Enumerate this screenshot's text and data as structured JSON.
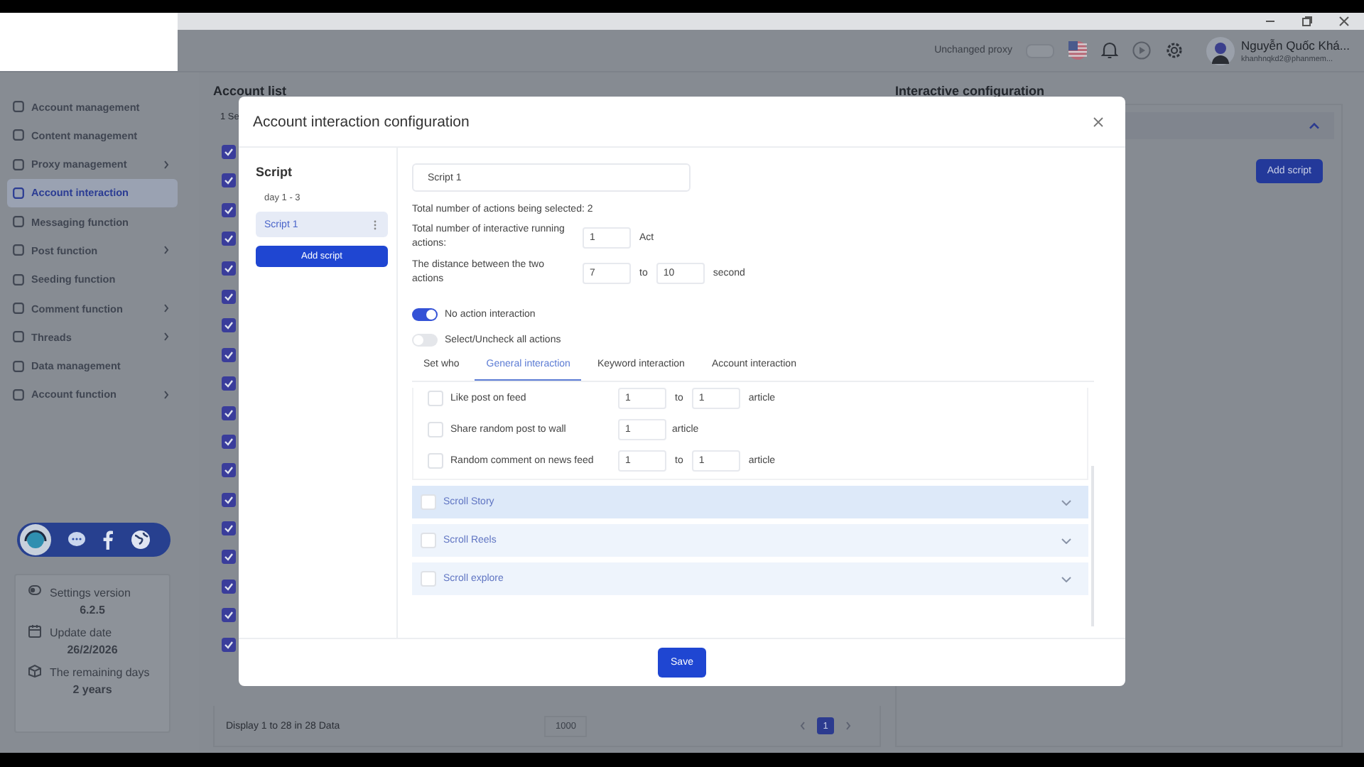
{
  "header": {
    "proxy_label": "Unchanged proxy",
    "proxy_on": false,
    "user_name": "Nguyễn Quốc Khá...",
    "user_email": "khanhnqkd2@phanmem..."
  },
  "sidebar": {
    "items": [
      {
        "label": "Account management",
        "selected": false,
        "has_submenu": false
      },
      {
        "label": "Content management",
        "selected": false,
        "has_submenu": false
      },
      {
        "label": "Proxy management",
        "selected": false,
        "has_submenu": true
      },
      {
        "label": "Account interaction",
        "selected": true,
        "has_submenu": false
      },
      {
        "label": "Messaging function",
        "selected": false,
        "has_submenu": false
      },
      {
        "label": "Post function",
        "selected": false,
        "has_submenu": true
      },
      {
        "label": "Seeding function",
        "selected": false,
        "has_submenu": false
      },
      {
        "label": "Comment function",
        "selected": false,
        "has_submenu": true
      },
      {
        "label": "Threads",
        "selected": false,
        "has_submenu": true
      },
      {
        "label": "Data management",
        "selected": false,
        "has_submenu": false
      },
      {
        "label": "Account function",
        "selected": false,
        "has_submenu": true
      }
    ],
    "info": [
      {
        "label": "Settings version",
        "value": "6.2.5"
      },
      {
        "label": "Update date",
        "value": "26/2/2026"
      },
      {
        "label": "The remaining days",
        "value": "2 years"
      }
    ]
  },
  "account_list": {
    "title": "Account list",
    "selection_text": "1 Se",
    "rows": [
      {
        "checked": true
      },
      {
        "checked": true
      },
      {
        "checked": true
      },
      {
        "checked": true
      },
      {
        "checked": true
      },
      {
        "checked": true
      },
      {
        "checked": true
      },
      {
        "checked": true
      },
      {
        "checked": true
      },
      {
        "checked": true
      },
      {
        "checked": true
      },
      {
        "checked": true
      },
      {
        "checked": true
      },
      {
        "checked": true
      },
      {
        "checked": true
      },
      {
        "checked": true
      },
      {
        "checked": true
      },
      {
        "checked": true
      }
    ],
    "footer_text": "Display 1 to 28 in 28 Data",
    "page_size": "1000",
    "pages": [
      {
        "label": "1",
        "selected": true
      }
    ]
  },
  "interactive_config": {
    "title": "Interactive configuration",
    "expanded": true,
    "add_button": "Add script"
  },
  "dialog": {
    "title": "Account interaction configuration",
    "script_heading": "Script",
    "day_range": "day 1 - 3",
    "scripts": [
      {
        "label": "Script 1",
        "selected": true
      }
    ],
    "add_button": "Add script",
    "script_name": "Script 1",
    "selected_count_text": "Total number of actions being selected: 2",
    "running_actions": {
      "label": "Total number of interactive running actions:",
      "value": "1",
      "unit": "Act"
    },
    "distance": {
      "label": "The distance between the two actions",
      "from": "7",
      "connector": "to",
      "to": "10",
      "unit": "second"
    },
    "toggles": [
      {
        "label": "No action interaction",
        "on": true
      },
      {
        "label": "Select/Uncheck all actions",
        "on": false
      }
    ],
    "tabs": [
      {
        "label": "Set who",
        "selected": false
      },
      {
        "label": "General interaction",
        "selected": true
      },
      {
        "label": "Keyword interaction",
        "selected": false
      },
      {
        "label": "Account interaction",
        "selected": false
      }
    ],
    "actions": [
      {
        "kind": "range",
        "label": "Like post on feed",
        "checked": false,
        "from": "1",
        "connector": "to",
        "to": "1",
        "unit": "article"
      },
      {
        "kind": "single",
        "label": "Share random post to wall",
        "checked": false,
        "from": "1",
        "unit": "article"
      },
      {
        "kind": "range",
        "label": "Random comment on news feed",
        "checked": false,
        "from": "1",
        "connector": "to",
        "to": "1",
        "unit": "article"
      }
    ],
    "groups": [
      {
        "label": "Scroll Story",
        "checked": false,
        "hovered": true
      },
      {
        "label": "Scroll Reels",
        "checked": false,
        "hovered": false
      },
      {
        "label": "Scroll explore",
        "checked": false,
        "hovered": false
      }
    ],
    "save_button": "Save"
  }
}
